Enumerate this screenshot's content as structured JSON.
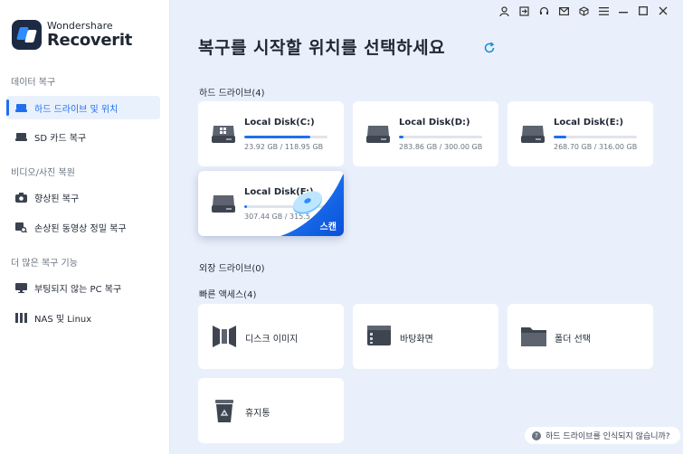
{
  "app": {
    "brand_small": "Wondershare",
    "brand_big": "Recoverit"
  },
  "sidebar": {
    "sections": [
      {
        "label": "데이터 복구",
        "items": [
          {
            "label": "하드 드라이브 및 위치",
            "icon": "hard-drive-icon",
            "active": true
          },
          {
            "label": "SD 카드 복구",
            "icon": "sd-card-icon",
            "active": false
          }
        ]
      },
      {
        "label": "비디오/사진 복원",
        "items": [
          {
            "label": "향상된 복구",
            "icon": "camera-icon",
            "active": false
          },
          {
            "label": "손상된 동영상 정밀 복구",
            "icon": "video-repair-icon",
            "active": false
          }
        ]
      },
      {
        "label": "더 많은 복구 기능",
        "items": [
          {
            "label": "부팅되지 않는 PC 복구",
            "icon": "monitor-icon",
            "active": false
          },
          {
            "label": "NAS 및 Linux",
            "icon": "nas-icon",
            "active": false
          }
        ]
      }
    ]
  },
  "titlebar": {
    "icons": [
      "user-icon",
      "sign-in-icon",
      "headset-icon",
      "mail-icon",
      "cube-icon",
      "menu-icon",
      "minimize-icon",
      "maximize-icon",
      "close-icon"
    ]
  },
  "main": {
    "title": "복구를 시작할 위치를 선택하세요",
    "hard_drives_label": "하드 드라이브(4)",
    "external_drives_label": "외장 드라이브(0)",
    "quick_access_label": "빠른 액세스(4)",
    "disks": [
      {
        "name": "Local Disk(C:)",
        "size": "23.92 GB / 118.95 GB",
        "used_fraction": 0.79,
        "os": true
      },
      {
        "name": "Local Disk(D:)",
        "size": "283.86 GB / 300.00 GB",
        "used_fraction": 0.05,
        "os": false
      },
      {
        "name": "Local Disk(E:)",
        "size": "268.70 GB / 316.00 GB",
        "used_fraction": 0.15,
        "os": false
      },
      {
        "name": "Local Disk(F:)",
        "size": "307.44 GB / 315.5",
        "used_fraction": 0.03,
        "os": false,
        "selected": true
      }
    ],
    "scan_label": "스캔",
    "quick_access": [
      {
        "label": "디스크 이미지",
        "icon": "disk-image-icon"
      },
      {
        "label": "바탕화면",
        "icon": "desktop-icon"
      },
      {
        "label": "폴더 선택",
        "icon": "folder-icon"
      },
      {
        "label": "휴지통",
        "icon": "recycle-bin-icon"
      }
    ],
    "help_text": "하드 드라이브를 인식되지 않습니까?"
  },
  "colors": {
    "accent": "#1f6ff0",
    "background": "#eaf0fb",
    "sidebar_active_bg": "#e9f1fd"
  }
}
